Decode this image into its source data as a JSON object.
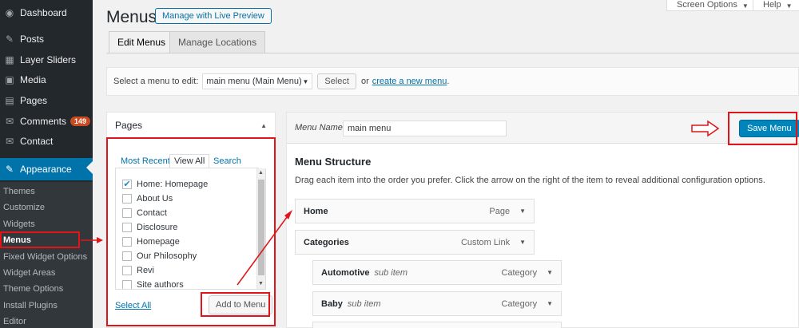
{
  "sidebar": {
    "items": [
      {
        "label": "Dashboard",
        "icon": "dashboard-icon",
        "glyph": "◉"
      },
      {
        "label": "Posts",
        "icon": "pin-icon",
        "glyph": "✎"
      },
      {
        "label": "Layer Sliders",
        "icon": "layers-icon",
        "glyph": "▦"
      },
      {
        "label": "Media",
        "icon": "media-icon",
        "glyph": "▣"
      },
      {
        "label": "Pages",
        "icon": "pages-icon",
        "glyph": "▤"
      },
      {
        "label": "Comments",
        "icon": "comment-icon",
        "glyph": "✉",
        "badge": "149"
      },
      {
        "label": "Contact",
        "icon": "envelope-icon",
        "glyph": "✉"
      },
      {
        "label": "Appearance",
        "icon": "appearance-icon",
        "glyph": "✎"
      }
    ],
    "submenu": [
      "Themes",
      "Customize",
      "Widgets",
      "Menus",
      "Fixed Widget Options",
      "Widget Areas",
      "Theme Options",
      "Install Plugins",
      "Editor"
    ]
  },
  "header": {
    "title": "Menus",
    "live_preview": "Manage with Live Preview",
    "screen_options": "Screen Options",
    "help": "Help"
  },
  "tabs": {
    "edit": "Edit Menus",
    "locations": "Manage Locations"
  },
  "select_bar": {
    "label": "Select a menu to edit:",
    "selected": "main menu (Main Menu)",
    "select_button": "Select",
    "or": "or",
    "create_link": "create a new menu",
    "period": "."
  },
  "pages_panel": {
    "title": "Pages",
    "tabs": [
      "Most Recent",
      "View All",
      "Search"
    ],
    "items": [
      {
        "label": "Home: Homepage",
        "checked": true
      },
      {
        "label": "About Us",
        "checked": false
      },
      {
        "label": "Contact",
        "checked": false
      },
      {
        "label": "Disclosure",
        "checked": false
      },
      {
        "label": "Homepage",
        "checked": false
      },
      {
        "label": "Our Philosophy",
        "checked": false
      },
      {
        "label": "Revi",
        "checked": false
      },
      {
        "label": "Site authors",
        "checked": false
      }
    ],
    "select_all": "Select All",
    "add_button": "Add to Menu"
  },
  "menu_panel": {
    "name_label": "Menu Name",
    "name_value": "main menu",
    "save_button": "Save Menu",
    "structure_title": "Menu Structure",
    "structure_desc": "Drag each item into the order you prefer. Click the arrow on the right of the item to reveal additional configuration options.",
    "items": [
      {
        "title": "Home",
        "sub": "",
        "type": "Page"
      },
      {
        "title": "Categories",
        "sub": "",
        "type": "Custom Link"
      },
      {
        "title": "Automotive",
        "sub": "sub item",
        "type": "Category"
      },
      {
        "title": "Baby",
        "sub": "sub item",
        "type": "Category"
      }
    ]
  },
  "colors": {
    "sidebar_bg": "#23282d",
    "accent": "#0073aa",
    "primary_button": "#0085ba",
    "annotation": "#e0151a",
    "badge": "#ca4a1f"
  }
}
